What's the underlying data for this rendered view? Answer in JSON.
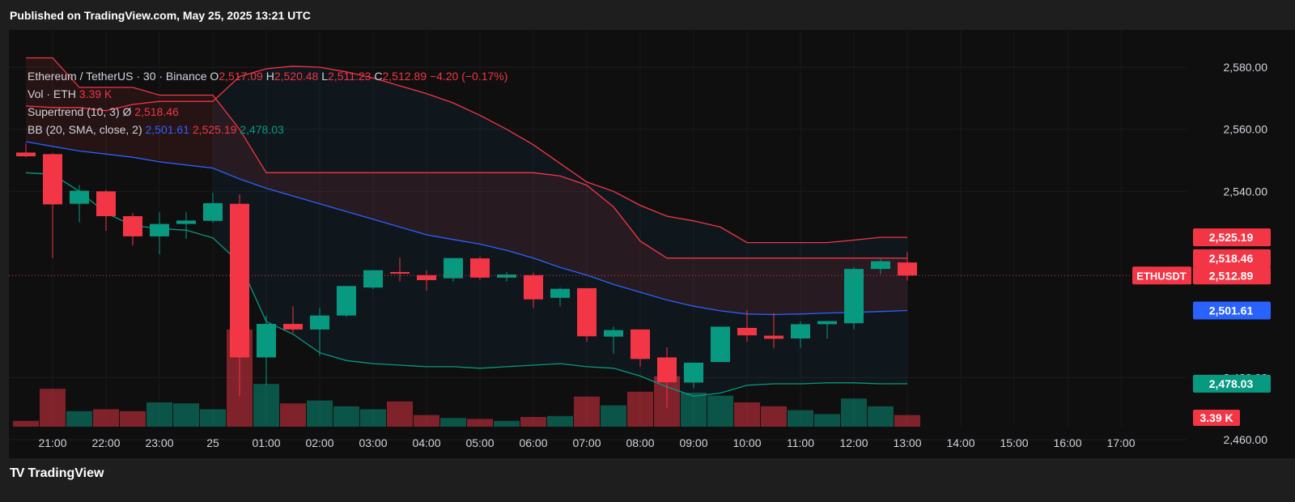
{
  "header": {
    "published": "Published on TradingView.com, May 25, 2025 13:21 UTC"
  },
  "legend": {
    "symbol": "Ethereum / TetherUS · 30 · Binance",
    "open_label": "O",
    "open": "2,517.09",
    "high_label": "H",
    "high": "2,520.48",
    "low_label": "L",
    "low": "2,511.23",
    "close_label": "C",
    "close": "2,512.89",
    "change": "−4.20 (−0.17%)",
    "vol_label": "Vol · ETH",
    "vol_value": "3.39 K",
    "supertrend_label": "Supertrend (10, 3)",
    "supertrend_symbol": "Ø",
    "supertrend_value": "2,518.46",
    "bb_label": "BB (20, SMA, close, 2)",
    "bb_basis": "2,501.61",
    "bb_upper": "2,525.19",
    "bb_lower": "2,478.03"
  },
  "footer": {
    "logo_mark": "TV",
    "brand": "TradingView"
  },
  "colors": {
    "up": "#089981",
    "down": "#f23645",
    "bb_basis": "#2962ff",
    "supertrend": "#f23645",
    "bb_lower_line": "#089981",
    "background": "#0f0f0f"
  },
  "chart_data": {
    "type": "candlestick",
    "symbol": "ETHUSDT",
    "interval": "30",
    "ylim": [
      2454,
      2592
    ],
    "y_ticks": [
      "2,460.00",
      "2,480.00",
      "2,540.00",
      "2,560.00",
      "2,580.00"
    ],
    "x_ticks": [
      {
        "label": "21:00",
        "t": 0
      },
      {
        "label": "22:00",
        "t": 2
      },
      {
        "label": "23:00",
        "t": 4
      },
      {
        "label": "25",
        "t": 6
      },
      {
        "label": "01:00",
        "t": 8
      },
      {
        "label": "02:00",
        "t": 10
      },
      {
        "label": "03:00",
        "t": 12
      },
      {
        "label": "04:00",
        "t": 14
      },
      {
        "label": "05:00",
        "t": 16
      },
      {
        "label": "06:00",
        "t": 18
      },
      {
        "label": "07:00",
        "t": 20
      },
      {
        "label": "08:00",
        "t": 22
      },
      {
        "label": "09:00",
        "t": 24
      },
      {
        "label": "10:00",
        "t": 26
      },
      {
        "label": "11:00",
        "t": 28
      },
      {
        "label": "12:00",
        "t": 30
      },
      {
        "label": "13:00",
        "t": 32
      },
      {
        "label": "14:00",
        "t": 34
      },
      {
        "label": "15:00",
        "t": 36
      },
      {
        "label": "16:00",
        "t": 38
      },
      {
        "label": "17:00",
        "t": 40
      }
    ],
    "candles": [
      {
        "t": -1,
        "o": 2552.5,
        "h": 2555.5,
        "l": 2551.0,
        "c": 2551.3
      },
      {
        "t": 0,
        "o": 2552.0,
        "h": 2552.3,
        "l": 2518.5,
        "c": 2535.8
      },
      {
        "t": 1,
        "o": 2536.0,
        "h": 2542.0,
        "l": 2530.0,
        "c": 2540.2
      },
      {
        "t": 2,
        "o": 2540.0,
        "h": 2540.5,
        "l": 2527.3,
        "c": 2532.0
      },
      {
        "t": 3,
        "o": 2532.0,
        "h": 2533.0,
        "l": 2522.5,
        "c": 2525.5
      },
      {
        "t": 4,
        "o": 2525.5,
        "h": 2533.3,
        "l": 2519.7,
        "c": 2529.5
      },
      {
        "t": 5,
        "o": 2529.5,
        "h": 2533.3,
        "l": 2524.7,
        "c": 2530.6
      },
      {
        "t": 6,
        "o": 2530.5,
        "h": 2539.5,
        "l": 2529.8,
        "c": 2536.2
      },
      {
        "t": 7,
        "o": 2536.0,
        "h": 2539.0,
        "l": 2474.0,
        "c": 2486.5
      },
      {
        "t": 8,
        "o": 2486.5,
        "h": 2500.0,
        "l": 2477.5,
        "c": 2497.3
      },
      {
        "t": 9,
        "o": 2497.3,
        "h": 2503.0,
        "l": 2494.5,
        "c": 2495.5
      },
      {
        "t": 10,
        "o": 2495.5,
        "h": 2502.5,
        "l": 2487.0,
        "c": 2500.0
      },
      {
        "t": 11,
        "o": 2500.0,
        "h": 2508.8,
        "l": 2499.5,
        "c": 2509.5
      },
      {
        "t": 12,
        "o": 2509.0,
        "h": 2514.5,
        "l": 2508.5,
        "c": 2514.6
      },
      {
        "t": 13,
        "o": 2514.0,
        "h": 2518.6,
        "l": 2511.0,
        "c": 2513.5
      },
      {
        "t": 14,
        "o": 2513.0,
        "h": 2514.5,
        "l": 2508.0,
        "c": 2511.4
      },
      {
        "t": 15,
        "o": 2512.0,
        "h": 2518.3,
        "l": 2511.0,
        "c": 2518.5
      },
      {
        "t": 16,
        "o": 2518.4,
        "h": 2519.0,
        "l": 2511.5,
        "c": 2512.2
      },
      {
        "t": 17,
        "o": 2512.2,
        "h": 2514.0,
        "l": 2511.0,
        "c": 2513.2
      },
      {
        "t": 18,
        "o": 2513.0,
        "h": 2513.8,
        "l": 2502.5,
        "c": 2505.2
      },
      {
        "t": 19,
        "o": 2505.7,
        "h": 2509.0,
        "l": 2503.0,
        "c": 2508.6
      },
      {
        "t": 20,
        "o": 2508.8,
        "h": 2508.8,
        "l": 2491.5,
        "c": 2493.3
      },
      {
        "t": 21,
        "o": 2493.2,
        "h": 2496.4,
        "l": 2487.7,
        "c": 2495.3
      },
      {
        "t": 22,
        "o": 2495.5,
        "h": 2495.5,
        "l": 2483.5,
        "c": 2486.0
      },
      {
        "t": 23,
        "o": 2486.5,
        "h": 2489.7,
        "l": 2470.3,
        "c": 2478.5
      },
      {
        "t": 24,
        "o": 2478.4,
        "h": 2484.4,
        "l": 2476.6,
        "c": 2484.8
      },
      {
        "t": 25,
        "o": 2485.0,
        "h": 2496.4,
        "l": 2485.0,
        "c": 2496.4
      },
      {
        "t": 26,
        "o": 2496.0,
        "h": 2501.7,
        "l": 2491.5,
        "c": 2493.6
      },
      {
        "t": 27,
        "o": 2493.5,
        "h": 2500.8,
        "l": 2489.5,
        "c": 2492.5
      },
      {
        "t": 28,
        "o": 2492.6,
        "h": 2498.1,
        "l": 2489.5,
        "c": 2497.2
      },
      {
        "t": 29,
        "o": 2497.2,
        "h": 2498.1,
        "l": 2492.5,
        "c": 2498.2
      },
      {
        "t": 30,
        "o": 2497.5,
        "h": 2515.5,
        "l": 2495.5,
        "c": 2515.0
      },
      {
        "t": 31,
        "o": 2515.0,
        "h": 2518.1,
        "l": 2513.3,
        "c": 2517.5
      },
      {
        "t": 32,
        "o": 2517.09,
        "h": 2520.48,
        "l": 2511.23,
        "c": 2512.89
      }
    ],
    "volumes": [
      {
        "t": -1,
        "v": 6,
        "dir": "down"
      },
      {
        "t": 0,
        "v": 39,
        "dir": "down"
      },
      {
        "t": 1,
        "v": 16,
        "dir": "up"
      },
      {
        "t": 2,
        "v": 18,
        "dir": "down"
      },
      {
        "t": 3,
        "v": 16,
        "dir": "down"
      },
      {
        "t": 4,
        "v": 25,
        "dir": "up"
      },
      {
        "t": 5,
        "v": 24,
        "dir": "up"
      },
      {
        "t": 6,
        "v": 18,
        "dir": "up"
      },
      {
        "t": 7,
        "v": 100,
        "dir": "down"
      },
      {
        "t": 8,
        "v": 44,
        "dir": "up"
      },
      {
        "t": 9,
        "v": 24,
        "dir": "down"
      },
      {
        "t": 10,
        "v": 27,
        "dir": "up"
      },
      {
        "t": 11,
        "v": 21,
        "dir": "up"
      },
      {
        "t": 12,
        "v": 18,
        "dir": "up"
      },
      {
        "t": 13,
        "v": 26,
        "dir": "down"
      },
      {
        "t": 14,
        "v": 12,
        "dir": "down"
      },
      {
        "t": 15,
        "v": 9,
        "dir": "up"
      },
      {
        "t": 16,
        "v": 8,
        "dir": "down"
      },
      {
        "t": 17,
        "v": 6,
        "dir": "up"
      },
      {
        "t": 18,
        "v": 10,
        "dir": "down"
      },
      {
        "t": 19,
        "v": 11,
        "dir": "up"
      },
      {
        "t": 20,
        "v": 31,
        "dir": "down"
      },
      {
        "t": 21,
        "v": 22,
        "dir": "up"
      },
      {
        "t": 22,
        "v": 36,
        "dir": "down"
      },
      {
        "t": 23,
        "v": 52,
        "dir": "down"
      },
      {
        "t": 24,
        "v": 35,
        "dir": "up"
      },
      {
        "t": 25,
        "v": 32,
        "dir": "up"
      },
      {
        "t": 26,
        "v": 25,
        "dir": "down"
      },
      {
        "t": 27,
        "v": 21,
        "dir": "down"
      },
      {
        "t": 28,
        "v": 17,
        "dir": "up"
      },
      {
        "t": 29,
        "v": 13,
        "dir": "up"
      },
      {
        "t": 30,
        "v": 29,
        "dir": "up"
      },
      {
        "t": 31,
        "v": 21,
        "dir": "up"
      },
      {
        "t": 32,
        "v": 12,
        "dir": "down"
      }
    ],
    "bb_basis": [
      [
        -1,
        2556
      ],
      [
        0,
        2554.5
      ],
      [
        1,
        2553
      ],
      [
        2,
        2552
      ],
      [
        3,
        2551
      ],
      [
        4,
        2549.5
      ],
      [
        5,
        2548.5
      ],
      [
        6,
        2547.5
      ],
      [
        7,
        2544
      ],
      [
        8,
        2541
      ],
      [
        9,
        2538.5
      ],
      [
        10,
        2536
      ],
      [
        11,
        2533.5
      ],
      [
        12,
        2531
      ],
      [
        13,
        2528.5
      ],
      [
        14,
        2526
      ],
      [
        15,
        2524.5
      ],
      [
        16,
        2523
      ],
      [
        17,
        2521
      ],
      [
        18,
        2518.5
      ],
      [
        19,
        2515.5
      ],
      [
        20,
        2513
      ],
      [
        21,
        2510
      ],
      [
        22,
        2507.5
      ],
      [
        23,
        2505
      ],
      [
        24,
        2503
      ],
      [
        25,
        2501.5
      ],
      [
        26,
        2500.5
      ],
      [
        27,
        2500.3
      ],
      [
        28,
        2500.5
      ],
      [
        29,
        2500.8
      ],
      [
        30,
        2501
      ],
      [
        31,
        2501.3
      ],
      [
        32,
        2501.61
      ]
    ],
    "bb_upper": [
      [
        6,
        2569
      ],
      [
        7,
        2577
      ],
      [
        8,
        2579.5
      ],
      [
        9,
        2580.3
      ],
      [
        10,
        2580
      ],
      [
        11,
        2578.5
      ],
      [
        12,
        2576.5
      ],
      [
        13,
        2574
      ],
      [
        14,
        2571.5
      ],
      [
        15,
        2568.5
      ],
      [
        16,
        2564.5
      ],
      [
        17,
        2560
      ],
      [
        18,
        2555
      ],
      [
        19,
        2549
      ],
      [
        20,
        2543
      ],
      [
        21,
        2540
      ],
      [
        22,
        2535.5
      ],
      [
        23,
        2532
      ],
      [
        24,
        2530.5
      ],
      [
        25,
        2528.5
      ],
      [
        26,
        2523.5
      ],
      [
        27,
        2523.5
      ],
      [
        28,
        2523.5
      ],
      [
        29,
        2523.5
      ],
      [
        30,
        2524.3
      ],
      [
        31,
        2525.2
      ],
      [
        32,
        2525.19
      ]
    ],
    "bb_lower": [
      [
        -1,
        2546
      ],
      [
        0,
        2545.5
      ],
      [
        1,
        2540
      ],
      [
        2,
        2533
      ],
      [
        3,
        2529
      ],
      [
        4,
        2528
      ],
      [
        5,
        2527.5
      ],
      [
        6,
        2525
      ],
      [
        7,
        2517
      ],
      [
        8,
        2498
      ],
      [
        9,
        2494
      ],
      [
        10,
        2488
      ],
      [
        11,
        2485.5
      ],
      [
        12,
        2484.5
      ],
      [
        13,
        2484
      ],
      [
        14,
        2483.5
      ],
      [
        15,
        2483.5
      ],
      [
        16,
        2483
      ],
      [
        17,
        2483.5
      ],
      [
        18,
        2484
      ],
      [
        19,
        2484.5
      ],
      [
        20,
        2483.5
      ],
      [
        21,
        2483
      ],
      [
        22,
        2480.5
      ],
      [
        23,
        2477
      ],
      [
        24,
        2474
      ],
      [
        25,
        2475
      ],
      [
        26,
        2477.5
      ],
      [
        27,
        2478
      ],
      [
        28,
        2478
      ],
      [
        29,
        2478.3
      ],
      [
        30,
        2478.3
      ],
      [
        31,
        2478
      ],
      [
        32,
        2478.03
      ]
    ],
    "supertrend": [
      [
        -1,
        2583
      ],
      [
        0,
        2583
      ],
      [
        1,
        2573.5
      ],
      [
        2,
        2573.5
      ],
      [
        3,
        2573.5
      ],
      [
        4,
        2571
      ],
      [
        5,
        2571
      ],
      [
        6,
        2571
      ],
      [
        7,
        2560
      ],
      [
        8,
        2546
      ],
      [
        9,
        2546
      ],
      [
        10,
        2546
      ],
      [
        11,
        2546
      ],
      [
        12,
        2546
      ],
      [
        13,
        2546
      ],
      [
        14,
        2546
      ],
      [
        15,
        2546
      ],
      [
        16,
        2546
      ],
      [
        17,
        2546
      ],
      [
        18,
        2546
      ],
      [
        19,
        2545
      ],
      [
        20,
        2542
      ],
      [
        21,
        2535
      ],
      [
        22,
        2524
      ],
      [
        23,
        2518.5
      ],
      [
        24,
        2518.5
      ],
      [
        25,
        2518.5
      ],
      [
        26,
        2518.5
      ],
      [
        27,
        2518.5
      ],
      [
        28,
        2518.5
      ],
      [
        29,
        2518.5
      ],
      [
        30,
        2518.5
      ],
      [
        31,
        2518.5
      ],
      [
        32,
        2518.46
      ]
    ],
    "supertrend_upper_past": [
      [
        -1,
        2567.5
      ],
      [
        0,
        2567
      ],
      [
        1,
        2567
      ],
      [
        2,
        2566
      ],
      [
        3,
        2568
      ],
      [
        4,
        2569
      ],
      [
        5,
        2569
      ],
      [
        6,
        2569
      ]
    ],
    "last_price": 2512.89,
    "price_labels": [
      {
        "value": 2525.19,
        "text": "2,525.19",
        "color": "#f23645"
      },
      {
        "value": 2518.46,
        "text": "2,518.46",
        "color": "#f23645"
      },
      {
        "value": 2512.89,
        "text": "2,512.89",
        "tag": "ETHUSDT",
        "color": "#f23645"
      },
      {
        "value": 2501.61,
        "text": "2,501.61",
        "color": "#2962ff"
      },
      {
        "value": 2478.03,
        "text": "2,478.03",
        "color": "#089981"
      }
    ],
    "volume_label": {
      "text": "3.39 K",
      "color": "#f23645"
    }
  }
}
